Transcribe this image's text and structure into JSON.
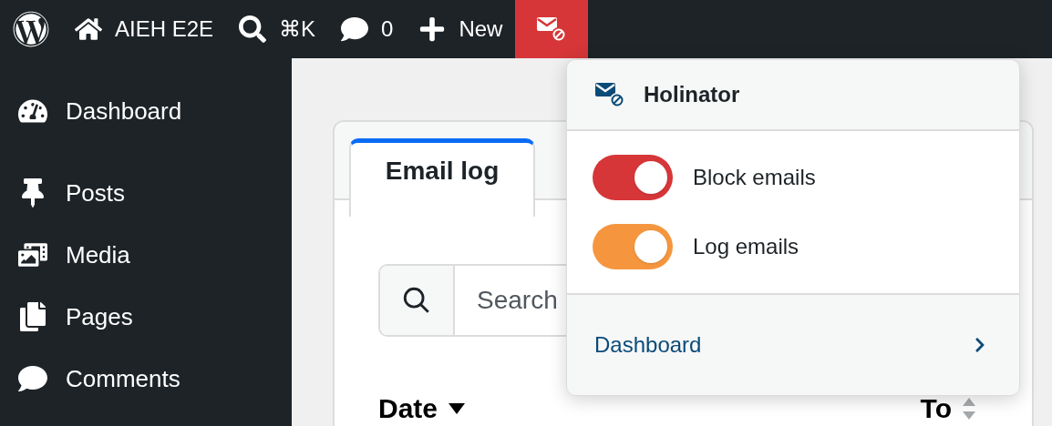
{
  "admin_bar": {
    "items": [
      {
        "kind": "wp"
      },
      {
        "kind": "home",
        "label": "AIEH E2E"
      },
      {
        "kind": "search",
        "label": "⌘K"
      },
      {
        "kind": "comments",
        "label": "0"
      },
      {
        "kind": "new",
        "label": "New"
      },
      {
        "kind": "holinator",
        "open": true
      }
    ]
  },
  "sidebar": {
    "items": [
      {
        "kind": "dashboard",
        "label": "Dashboard"
      },
      {
        "kind": "posts",
        "label": "Posts"
      },
      {
        "kind": "media",
        "label": "Media"
      },
      {
        "kind": "pages",
        "label": "Pages"
      },
      {
        "kind": "comments",
        "label": "Comments"
      }
    ]
  },
  "card": {
    "tabs": [
      {
        "label": "Email log",
        "selected": true
      }
    ],
    "search": {
      "placeholder": "Search"
    },
    "columns": [
      {
        "label": "Date",
        "sorted": true
      },
      {
        "label": "To",
        "sorted": false
      }
    ]
  },
  "dropdown": {
    "title": "Holinator",
    "toggles": [
      {
        "label": "Block emails",
        "on": true,
        "color": "#d63638"
      },
      {
        "label": "Log emails",
        "on": true,
        "color": "#f5963f"
      }
    ],
    "link": "Dashboard"
  }
}
